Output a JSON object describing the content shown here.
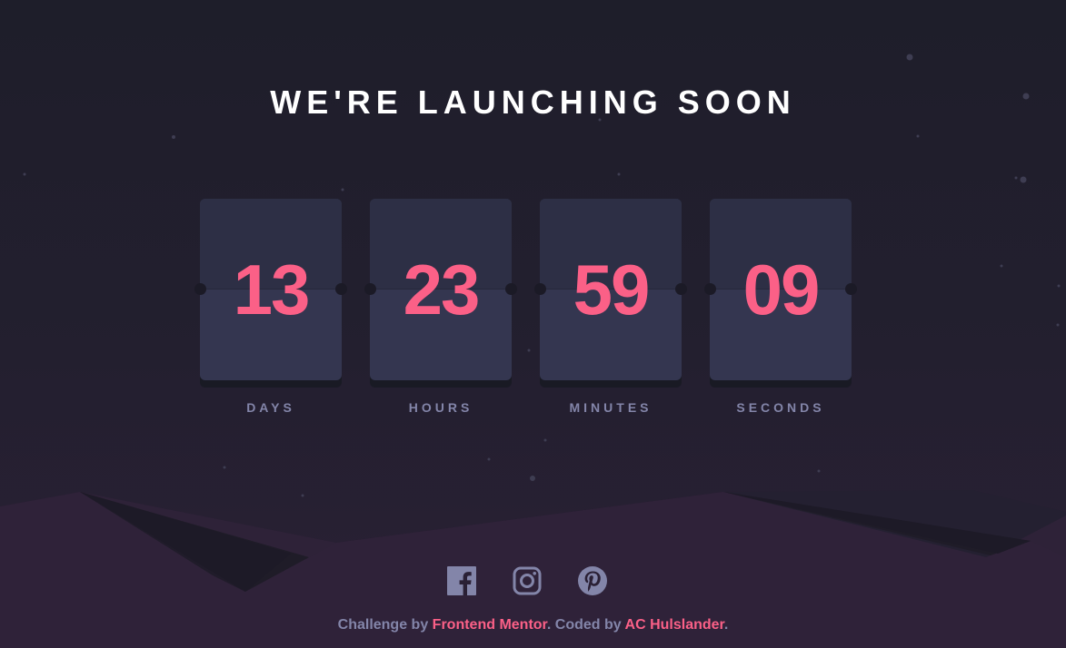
{
  "title": "WE'RE LAUNCHING SOON",
  "countdown": [
    {
      "value": "13",
      "label": "DAYS"
    },
    {
      "value": "23",
      "label": "HOURS"
    },
    {
      "value": "59",
      "label": "MINUTES"
    },
    {
      "value": "09",
      "label": "SECONDS"
    }
  ],
  "social": [
    "facebook-icon",
    "instagram-icon",
    "pinterest-icon"
  ],
  "footer": {
    "prefix": "Challenge by",
    "link1": "Frontend Mentor",
    "middle": ". Coded by",
    "link2": "AC Hulslander",
    "suffix": "."
  },
  "colors": {
    "accent": "#fb6087",
    "muted": "#8385a9",
    "card": "#343650",
    "background": "#1e1e2a"
  }
}
